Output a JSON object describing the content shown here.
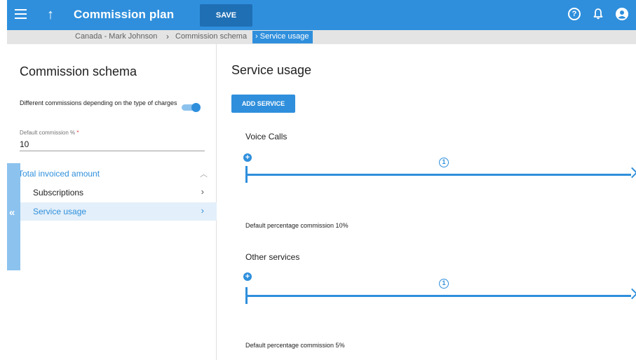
{
  "header": {
    "title": "Commission plan",
    "save_label": "SAVE",
    "icons": [
      "menu-icon",
      "arrow-up-icon",
      "help-icon",
      "bell-icon",
      "account-icon"
    ],
    "accent_color": "#2f8fdc"
  },
  "breadcrumb": {
    "items": [
      "Canada - Mark Johnson",
      "Commission schema",
      "Service usage"
    ],
    "separator": "›"
  },
  "sidebar": {
    "title": "Commission schema",
    "toggle": {
      "label": "Different commissions depending on the type of charges",
      "on": true
    },
    "default_commission": {
      "label": "Default commission %",
      "required_mark": "*",
      "value": "10"
    },
    "group": {
      "label": "Total invoiced amount",
      "expanded": true,
      "items": [
        {
          "label": "Subscriptions",
          "selected": false
        },
        {
          "label": "Service usage",
          "selected": true
        }
      ]
    },
    "collapse_glyph": "«"
  },
  "main": {
    "title": "Service usage",
    "add_button": "ADD SERVICE",
    "services": [
      {
        "name": "Voice Calls",
        "add_glyph": "+",
        "marker": "1",
        "note": "Default percentage commission 10%"
      },
      {
        "name": "Other services",
        "add_glyph": "+",
        "marker": "1",
        "note": "Default percentage commission 5%"
      }
    ]
  }
}
